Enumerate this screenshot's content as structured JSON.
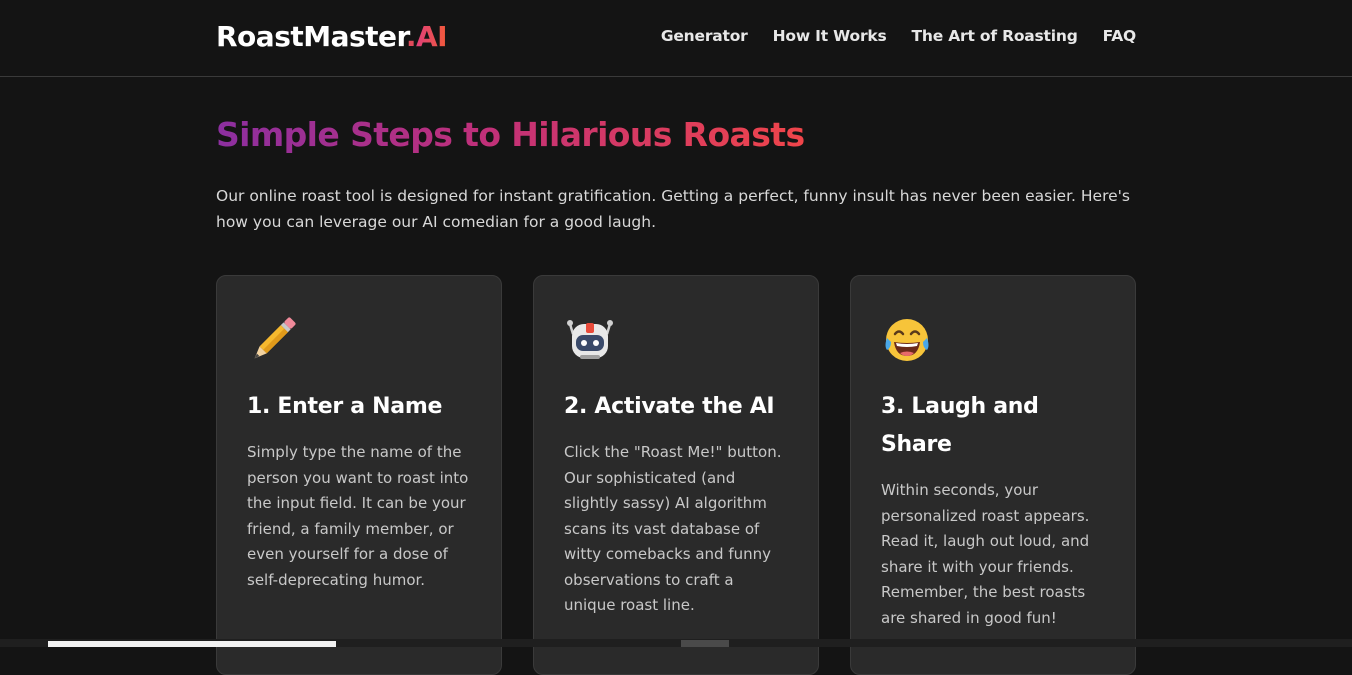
{
  "header": {
    "logo_main": "RoastMaster",
    "logo_dot": ".",
    "logo_suffix": "AI",
    "nav": [
      {
        "label": "Generator"
      },
      {
        "label": "How It Works"
      },
      {
        "label": "The Art of Roasting"
      },
      {
        "label": "FAQ"
      }
    ]
  },
  "section": {
    "title": "Simple Steps to Hilarious Roasts",
    "intro": "Our online roast tool is designed for instant gratification. Getting a perfect, funny insult has never been easier. Here's how you can leverage our AI comedian for a good laugh."
  },
  "steps": [
    {
      "icon": "pencil-icon",
      "title": "1. Enter a Name",
      "text": "Simply type the name of the person you want to roast into the input field. It can be your friend, a family member, or even yourself for a dose of self-deprecating humor."
    },
    {
      "icon": "robot-icon",
      "title": "2. Activate the AI",
      "text": "Click the \"Roast Me!\" button. Our sophisticated (and slightly sassy) AI algorithm scans its vast database of witty comebacks and funny observations to craft a unique roast line."
    },
    {
      "icon": "laughing-face-icon",
      "title": "3. Laugh and Share",
      "text": "Within seconds, your personalized roast appears. Read it, laugh out loud, and share it with your friends. Remember, the best roasts are shared in good fun!"
    }
  ],
  "colors": {
    "background": "#141414",
    "card": "#2a2a2a",
    "gradient_start": "#8c2fa0",
    "gradient_end": "#f0454a"
  }
}
